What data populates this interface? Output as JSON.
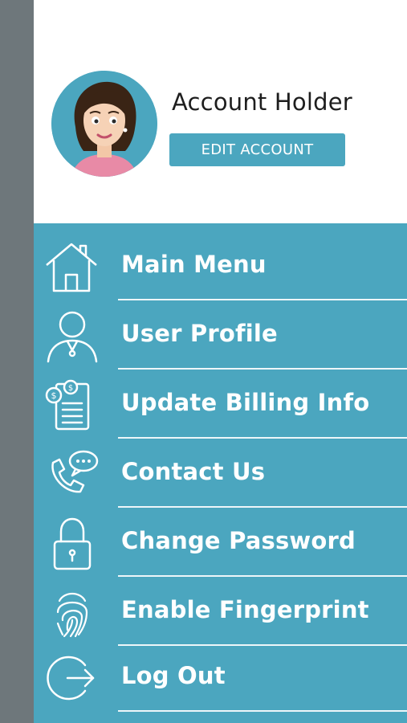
{
  "account": {
    "name": "Account Holder",
    "edit_label": "EDIT ACCOUNT"
  },
  "menu": {
    "items": [
      {
        "label": "Main Menu",
        "icon": "home-icon"
      },
      {
        "label": "User Profile",
        "icon": "user-icon"
      },
      {
        "label": "Update Billing Info",
        "icon": "billing-icon"
      },
      {
        "label": "Contact Us",
        "icon": "contact-icon"
      },
      {
        "label": "Change Password",
        "icon": "lock-icon"
      },
      {
        "label": "Enable Fingerprint",
        "icon": "fingerprint-icon"
      },
      {
        "label": "Log Out",
        "icon": "logout-icon"
      }
    ]
  },
  "colors": {
    "accent": "#4ba6bf",
    "side_strip": "#6e777b",
    "header_bg": "#ffffff"
  }
}
